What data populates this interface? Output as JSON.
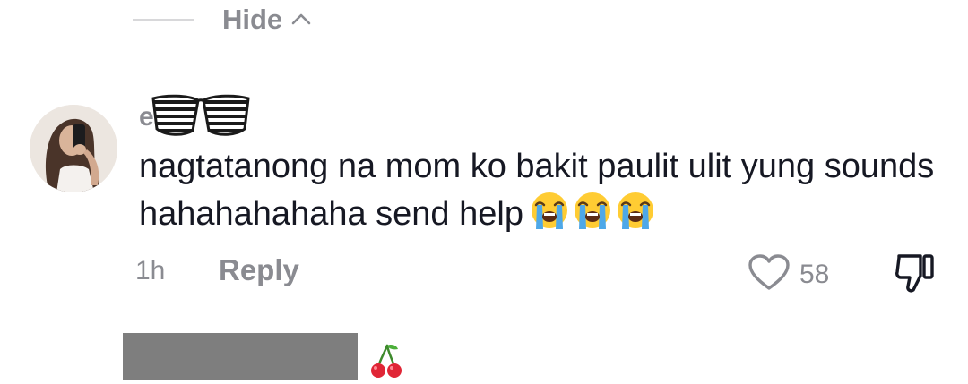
{
  "replies_toggle": {
    "label": "Hide",
    "icon": "chevron-up-icon"
  },
  "comment": {
    "username_visible": "e",
    "username_overlay": "shutter-shades-emoji",
    "text": "nagtatanong na mom ko bakit paulit ulit yung sounds hahahahahaha send help",
    "emojis": [
      "loudly-crying-face",
      "loudly-crying-face",
      "loudly-crying-face"
    ],
    "time": "1h",
    "reply_label": "Reply",
    "like_count": "58"
  },
  "next_comment": {
    "name_redacted": true,
    "emoji": "cherries"
  },
  "colors": {
    "text": "#161823",
    "muted": "#8a8b91",
    "divider": "#d8d8da",
    "redaction": "#7e7e7e"
  }
}
